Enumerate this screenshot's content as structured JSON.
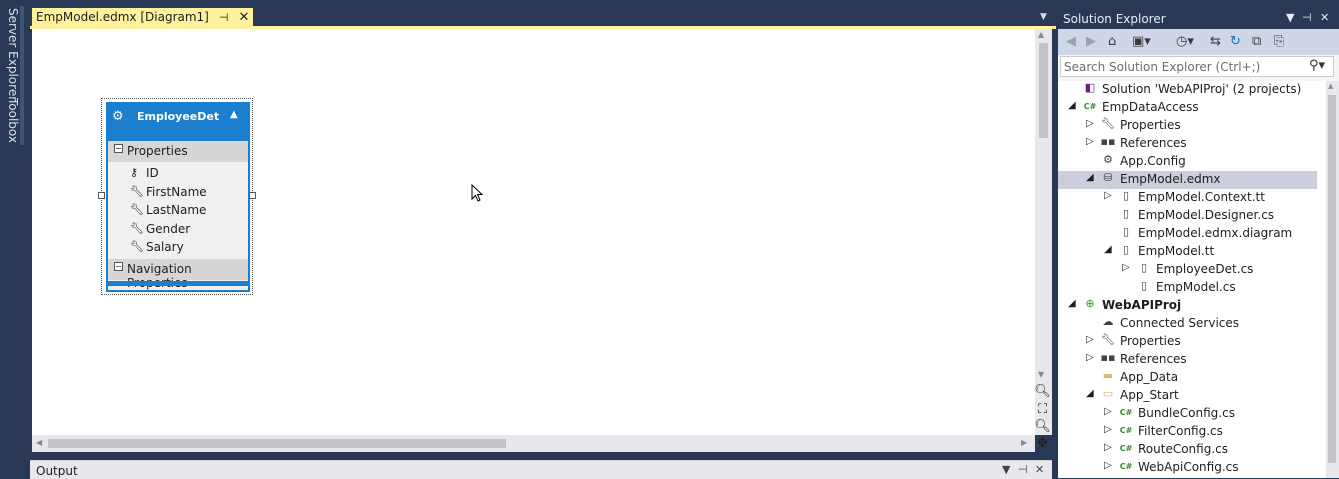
{
  "left_strip": {
    "server_explorer": "Server Explorer",
    "toolbox": "Toolbox"
  },
  "document_tab": {
    "title": "EmpModel.edmx [Diagram1]",
    "pin_glyph": "⊣",
    "close_glyph": "✕"
  },
  "tab_dropdown_glyph": "▼",
  "entity": {
    "name": "EmployeeDet",
    "icon": "entity-icon",
    "properties_label": "Properties",
    "properties": [
      {
        "name": "ID",
        "icon": "key-icon"
      },
      {
        "name": "FirstName",
        "icon": "wrench-icon"
      },
      {
        "name": "LastName",
        "icon": "wrench-icon"
      },
      {
        "name": "Gender",
        "icon": "wrench-icon"
      },
      {
        "name": "Salary",
        "icon": "wrench-icon"
      }
    ],
    "navigation_label": "Navigation Properties"
  },
  "zoom_controls": [
    "zoom-in-icon",
    "zoom-to-fit-icon",
    "zoom-out-icon",
    "pan-icon"
  ],
  "output_panel": {
    "title": "Output"
  },
  "solution_explorer": {
    "title": "Solution Explorer",
    "search_placeholder": "Search Solution Explorer (Ctrl+;)",
    "toolbar_icons": [
      "back-icon",
      "forward-icon",
      "home-icon",
      "switch-views-icon",
      "pending-changes-icon",
      "sync-icon",
      "refresh-icon",
      "collapse-all-icon",
      "show-all-files-icon"
    ],
    "tree": [
      {
        "label": "Solution 'WebAPIProj' (2 projects)",
        "icon": "solution-icon",
        "level": 0,
        "expander": ""
      },
      {
        "label": "EmpDataAccess",
        "icon": "csharp-project-icon",
        "level": 0,
        "expander": "◢",
        "bold": false
      },
      {
        "label": "Properties",
        "icon": "wrench-icon",
        "level": 1,
        "expander": "▷"
      },
      {
        "label": "References",
        "icon": "references-icon",
        "level": 1,
        "expander": "▷"
      },
      {
        "label": "App.Config",
        "icon": "config-file-icon",
        "level": 1,
        "expander": ""
      },
      {
        "label": "EmpModel.edmx",
        "icon": "edmx-icon",
        "level": 1,
        "expander": "◢",
        "selected": true
      },
      {
        "label": "EmpModel.Context.tt",
        "icon": "file-icon",
        "level": 2,
        "expander": "▷"
      },
      {
        "label": "EmpModel.Designer.cs",
        "icon": "file-icon",
        "level": 2,
        "expander": ""
      },
      {
        "label": "EmpModel.edmx.diagram",
        "icon": "file-icon",
        "level": 2,
        "expander": ""
      },
      {
        "label": "EmpModel.tt",
        "icon": "file-icon",
        "level": 2,
        "expander": "◢"
      },
      {
        "label": "EmployeeDet.cs",
        "icon": "file-icon",
        "level": 3,
        "expander": "▷"
      },
      {
        "label": "EmpModel.cs",
        "icon": "file-icon",
        "level": 3,
        "expander": ""
      },
      {
        "label": "WebAPIProj",
        "icon": "web-project-icon",
        "level": 0,
        "expander": "◢",
        "bold": true
      },
      {
        "label": "Connected Services",
        "icon": "cloud-icon",
        "level": 1,
        "expander": ""
      },
      {
        "label": "Properties",
        "icon": "wrench-icon",
        "level": 1,
        "expander": "▷"
      },
      {
        "label": "References",
        "icon": "references-icon",
        "level": 1,
        "expander": "▷"
      },
      {
        "label": "App_Data",
        "icon": "folder-icon",
        "level": 1,
        "expander": ""
      },
      {
        "label": "App_Start",
        "icon": "folder-open-icon",
        "level": 1,
        "expander": "◢"
      },
      {
        "label": "BundleConfig.cs",
        "icon": "csharp-file-icon",
        "level": 2,
        "expander": "▷"
      },
      {
        "label": "FilterConfig.cs",
        "icon": "csharp-file-icon",
        "level": 2,
        "expander": "▷"
      },
      {
        "label": "RouteConfig.cs",
        "icon": "csharp-file-icon",
        "level": 2,
        "expander": "▷"
      },
      {
        "label": "WebApiConfig.cs",
        "icon": "csharp-file-icon",
        "level": 2,
        "expander": "▷"
      }
    ]
  },
  "colors": {
    "chrome": "#293955",
    "tab_active": "#fff29d",
    "entity_blue": "#1c7ecf",
    "selection": "#cccedb"
  }
}
